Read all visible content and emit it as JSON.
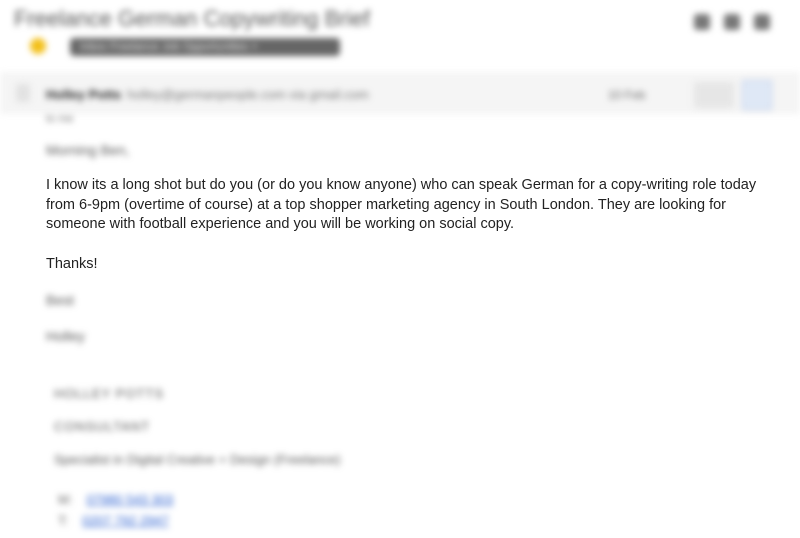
{
  "email": {
    "subject": "Freelance German Copywriting Brief",
    "label_chip": "Inbox  Freelance Job Opportunities  ×",
    "sender_name": "Holley Potts",
    "sender_address": "holley@germanpeople.com via gmail.com",
    "date": "10 Feb",
    "to_line": "to me",
    "greeting": "Morning Ben,",
    "body": "I know its a long shot but do you (or do you know anyone) who can speak German for a copy-writing role today from 6-9pm (overtime of course) at a top shopper marketing agency in South London. They are looking for someone with football experience and you will be working on social copy.",
    "thanks": "Thanks!",
    "signoff_1": "Best",
    "signoff_2": "Holley"
  },
  "signature": {
    "name": "HOLLEY POTTS",
    "role": "CONSULTANT",
    "specialism": "Specialist in Digital Creative + Design (Freelance)",
    "phones": [
      {
        "label": "M:",
        "number": "07980 543 303"
      },
      {
        "label": "T:",
        "number": "0207 792 2947"
      }
    ]
  },
  "icons": {
    "header": [
      "print-icon",
      "new-window-icon",
      "more-icon"
    ],
    "star": "star-icon",
    "reply": "reply-icon",
    "more": "dropdown-icon"
  },
  "colors": {
    "star": "#f3c01a",
    "link": "#2a5fd0",
    "chip": "#666666"
  }
}
